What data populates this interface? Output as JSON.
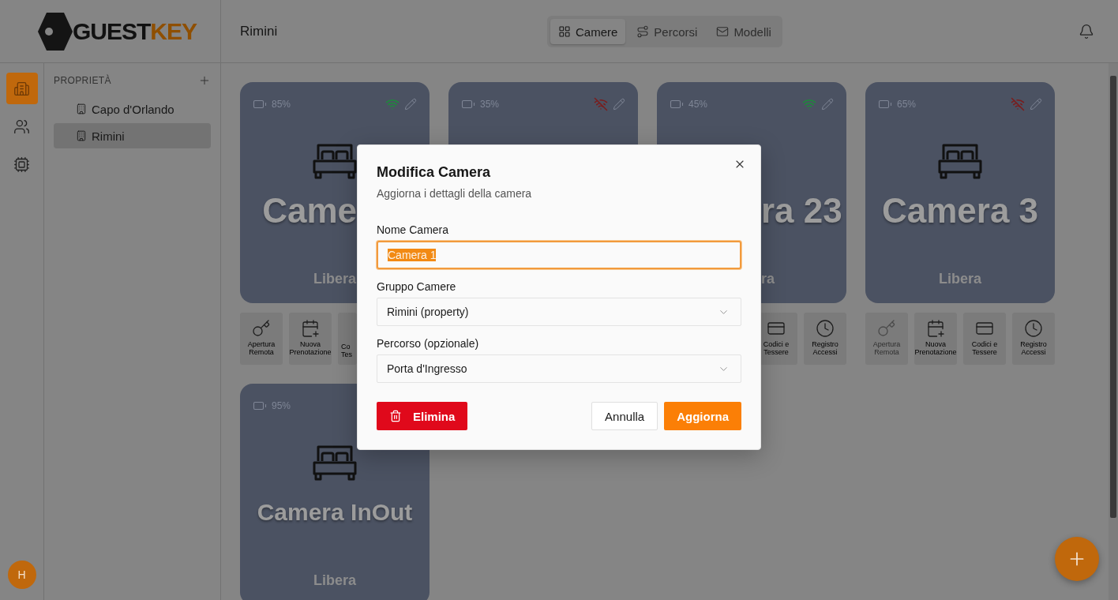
{
  "logo": {
    "part_1": "GUEST",
    "part_2": "KEY"
  },
  "header": {
    "title": "Rimini"
  },
  "tabs": [
    {
      "label": "Camere",
      "selected": true
    },
    {
      "label": "Percorsi",
      "selected": false
    },
    {
      "label": "Modelli",
      "selected": false
    }
  ],
  "rail": [
    {
      "selected": true
    },
    {
      "selected": false
    },
    {
      "selected": false
    }
  ],
  "user_avatar": {
    "initial": "H"
  },
  "properties": {
    "heading": "PROPRIETÀ",
    "items": [
      {
        "name": "Capo d'Orlando",
        "selected": false
      },
      {
        "name": "Rimini",
        "selected": true
      }
    ]
  },
  "rooms": [
    {
      "battery": "85%",
      "online": true,
      "title": "Came",
      "status": "Libera",
      "actions": [
        {
          "label": "Apertura Remota",
          "kind": "key",
          "disabled": false
        },
        {
          "label": "Nuova Prenotazione",
          "kind": "calendar",
          "disabled": false
        },
        {
          "label": "Co Tes",
          "disabled": false
        }
      ]
    },
    {
      "battery": "35%",
      "online": false
    },
    {
      "battery": "45%",
      "online": true,
      "title": "ra 23",
      "status": "ra",
      "actions": [
        {
          "label": "Codici e Tessere",
          "kind": "card",
          "disabled": false
        },
        {
          "label": "Registro Accessi",
          "kind": "clock",
          "disabled": false
        }
      ]
    },
    {
      "battery": "65%",
      "online": false,
      "title": "Camera 3",
      "status": "Libera",
      "actions": [
        {
          "label": "Apertura Remota",
          "kind": "key",
          "disabled": true
        },
        {
          "label": "Nuova Prenotazione",
          "kind": "calendar",
          "disabled": false
        },
        {
          "label": "Codici e Tessere",
          "kind": "card",
          "disabled": false
        },
        {
          "label": "Registro Accessi",
          "kind": "clock",
          "disabled": false
        }
      ]
    },
    {
      "battery": "95%",
      "title": "Camera InOut",
      "status": "Libera"
    }
  ],
  "dialog": {
    "title": "Modifica Camera",
    "subtitle": "Aggiorna i dettagli della camera",
    "fields": [
      {
        "label": "Nome Camera",
        "kind": "text",
        "value": "Camera 1",
        "focused": true,
        "text_selected": true
      },
      {
        "label": "Gruppo Camere",
        "kind": "select",
        "value": "Rimini (property)"
      },
      {
        "label": "Percorso (opzionale)",
        "kind": "select",
        "value": "Porta d'Ingresso"
      }
    ],
    "buttons": [
      {
        "label": "Elimina",
        "kind": "danger"
      },
      {
        "label": "Annulla",
        "kind": "secondary"
      },
      {
        "label": "Aggiorna",
        "kind": "primary"
      }
    ]
  }
}
